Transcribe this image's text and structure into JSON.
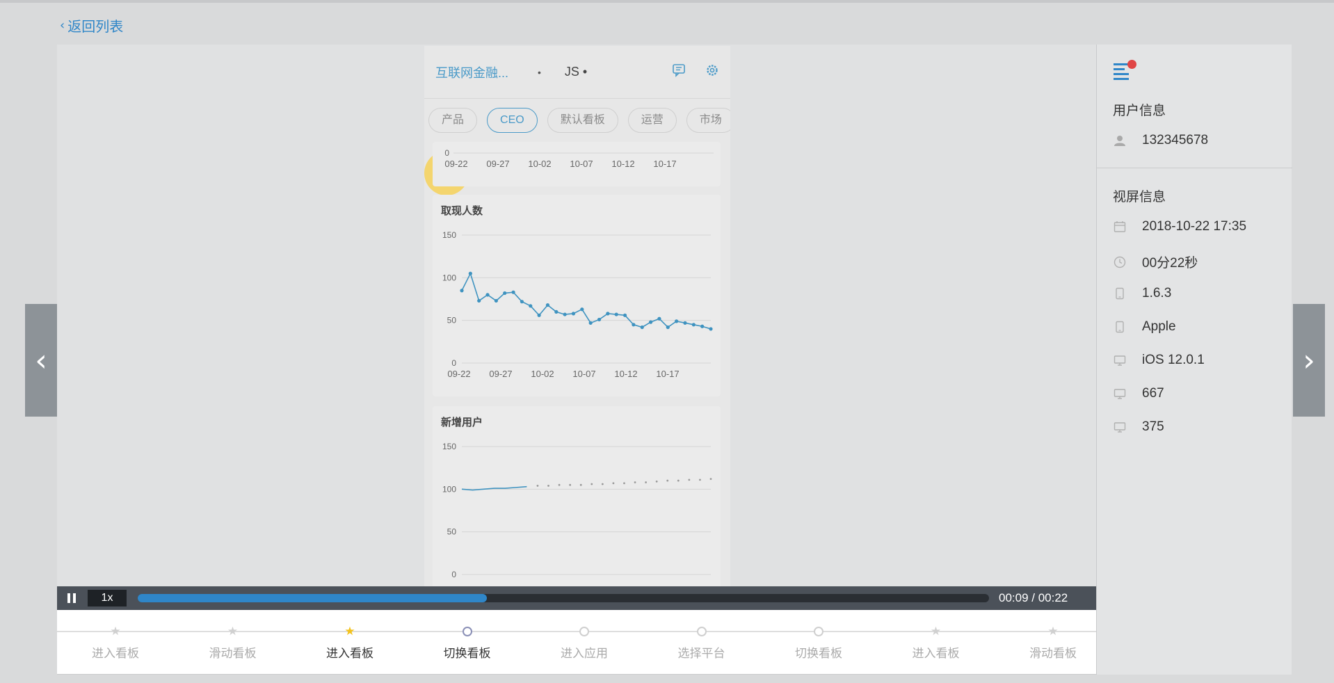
{
  "back": {
    "label": "返回列表"
  },
  "phone": {
    "app_select": "互联网金融...",
    "separator_dot": "•",
    "platform": "JS •",
    "tabs": [
      "产品",
      "CEO",
      "默认看板",
      "运营",
      "市场"
    ],
    "active_tab": "CEO",
    "touch_highlight_color": "#f8cf46",
    "prev_chart": {
      "x_ticks": [
        "09-22",
        "09-27",
        "10-02",
        "10-07",
        "10-12",
        "10-17"
      ],
      "visible_y_tick": "0"
    }
  },
  "chart_data": [
    {
      "type": "line",
      "title": "取现人数",
      "xlabel": "",
      "ylabel": "",
      "ylim": [
        0,
        150
      ],
      "y_ticks": [
        "150",
        "100",
        "50",
        "0"
      ],
      "x_ticks": [
        "09-22",
        "09-27",
        "10-02",
        "10-07",
        "10-12",
        "10-17"
      ],
      "series": [
        {
          "values": [
            85,
            105,
            73,
            80,
            73,
            82,
            83,
            72,
            67,
            56,
            68,
            60,
            57,
            58,
            63,
            47,
            51,
            58,
            57,
            56,
            45,
            42,
            48,
            52,
            42,
            49,
            47,
            45,
            43,
            40
          ],
          "color": "#3f93c0"
        }
      ],
      "grid": true
    },
    {
      "type": "line",
      "title": "新增用户",
      "xlabel": "",
      "ylabel": "",
      "ylim": [
        0,
        150
      ],
      "y_ticks": [
        "150",
        "100",
        "50",
        "0"
      ],
      "series": [
        {
          "values": [
            100,
            99,
            100,
            101,
            101,
            102,
            103
          ],
          "color": "#3f93c0"
        },
        {
          "values": [
            104,
            104,
            105,
            105,
            105,
            106,
            106,
            107,
            107,
            108,
            108,
            109,
            110,
            110,
            111,
            111,
            112
          ],
          "color": "#9a9a9a",
          "style": "dotted"
        }
      ],
      "grid": true
    }
  ],
  "player": {
    "speed": "1x",
    "progress": 0.41,
    "time": "00:09 / 00:22"
  },
  "timeline": [
    {
      "label": "进入看板",
      "marker": "star",
      "state": "past"
    },
    {
      "label": "滑动看板",
      "marker": "star",
      "state": "past"
    },
    {
      "label": "进入看板",
      "marker": "star",
      "state": "current"
    },
    {
      "label": "切换看板",
      "marker": "circle",
      "state": "visited"
    },
    {
      "label": "进入应用",
      "marker": "circle",
      "state": "future"
    },
    {
      "label": "选择平台",
      "marker": "circle",
      "state": "future"
    },
    {
      "label": "切换看板",
      "marker": "circle",
      "state": "future"
    },
    {
      "label": "进入看板",
      "marker": "star",
      "state": "future"
    },
    {
      "label": "滑动看板",
      "marker": "star",
      "state": "future"
    }
  ],
  "nav": {
    "prev_glyph": "‹",
    "next_glyph": "›"
  },
  "sidebar": {
    "user_title": "用户信息",
    "user_id": "132345678",
    "screen_title": "视屏信息",
    "items": [
      {
        "icon": "calendar-icon",
        "value": "2018-10-22 17:35"
      },
      {
        "icon": "clock-icon",
        "value": "00分22秒"
      },
      {
        "icon": "phone-icon",
        "value": "1.6.3"
      },
      {
        "icon": "phone-icon",
        "value": "Apple"
      },
      {
        "icon": "monitor-icon",
        "value": "iOS 12.0.1"
      },
      {
        "icon": "monitor-icon",
        "value": "667"
      },
      {
        "icon": "monitor-icon",
        "value": "375"
      }
    ]
  },
  "colors": {
    "accent": "#2f86c8",
    "badge": "#e04545",
    "star_current": "#f3c21b"
  }
}
